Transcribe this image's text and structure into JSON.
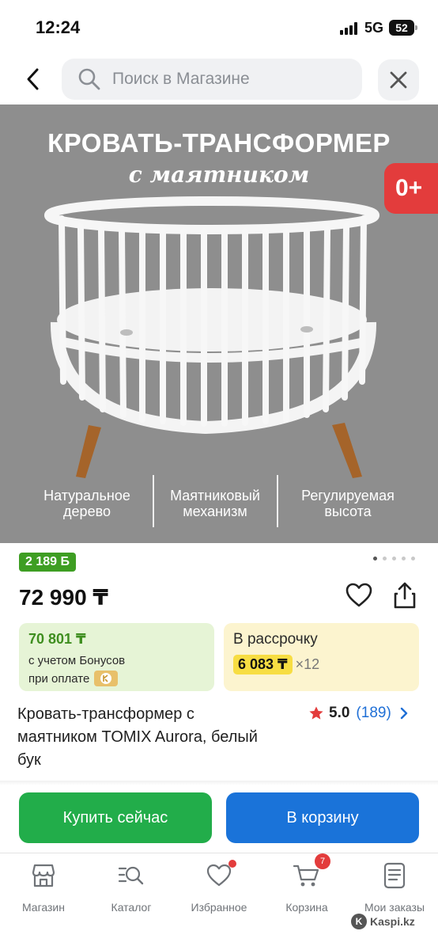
{
  "status_bar": {
    "time": "12:24",
    "network": "5G",
    "battery": "52"
  },
  "search": {
    "placeholder": "Поиск в Магазине"
  },
  "hero": {
    "title": "КРОВАТЬ-ТРАНСФОРМЕР",
    "subtitle": "с маятником",
    "age_badge": "0+",
    "features": [
      {
        "line1": "Натуральное",
        "line2": "дерево"
      },
      {
        "line1": "Маятниковый",
        "line2": "механизм"
      },
      {
        "line1": "Регулируемая",
        "line2": "высота"
      }
    ],
    "gallery_dots_total": 5,
    "gallery_dots_active": 1
  },
  "product": {
    "bonus_badge": "2 189 Б",
    "price": "72 990 ₸",
    "bonus_card": {
      "amount": "70 801 ₸",
      "line1": "с учетом Бонусов",
      "line2": "при оплате"
    },
    "installment": {
      "label": "В рассрочку",
      "monthly": "6 083 ₸",
      "multiplier": "×12"
    },
    "title": "Кровать-трансформер с маятником TOMIX Aurora, белый бук",
    "rating": {
      "score": "5.0",
      "count": "(189)"
    }
  },
  "actions": {
    "buy_now": "Купить сейчас",
    "add_to_cart": "В корзину"
  },
  "bottom_nav": {
    "items": [
      {
        "label": "Магазин",
        "icon": "store-icon"
      },
      {
        "label": "Каталог",
        "icon": "catalog-search-icon"
      },
      {
        "label": "Избранное",
        "icon": "heart-icon"
      },
      {
        "label": "Корзина",
        "icon": "cart-icon"
      },
      {
        "label": "Мои заказы",
        "icon": "orders-icon"
      }
    ],
    "cart_count": "7"
  },
  "watermark": "Kaspi.kz",
  "colors": {
    "buy_button": "#22ad4a",
    "cart_button": "#1a73d9",
    "bonus_green": "#3e9e23",
    "installment_yellow": "#f7dd43",
    "badge_red": "#e33c3c",
    "rating_count_blue": "#1f6fd6"
  }
}
